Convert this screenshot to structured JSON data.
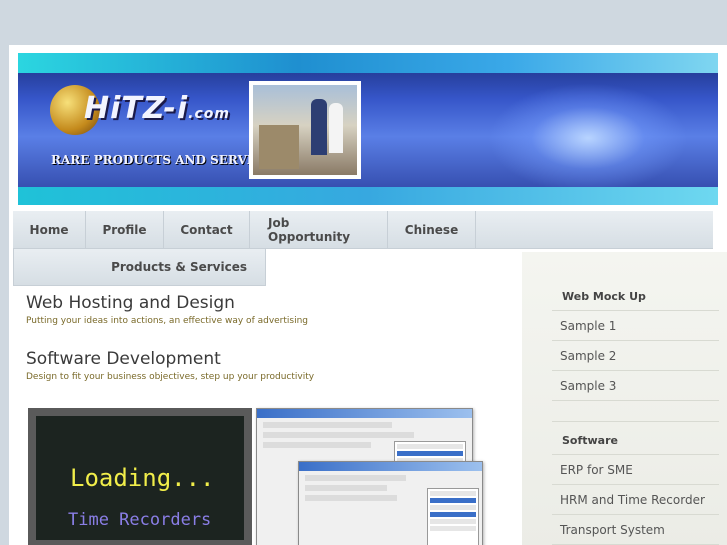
{
  "brand": {
    "logo_text": "HiTZ-i",
    "logo_domain": ".com",
    "logo_small_text": "Rare Products & Services Centre",
    "tagline": "RARE PRODUCTS AND SERVICES"
  },
  "nav": {
    "items": [
      "Home",
      "Profile",
      "Contact",
      "Job Opportunity",
      "Chinese"
    ],
    "second_row": [
      "Products & Services"
    ]
  },
  "main": {
    "sections": [
      {
        "title": "Web Hosting and Design",
        "subtitle": "Putting your ideas into actions, an effective way of advertising"
      },
      {
        "title": "Software Development",
        "subtitle": "Design to fit your business objectives, step up your productivity"
      }
    ],
    "screenshot": {
      "line1": "Loading...",
      "line2": "Time Recorders"
    }
  },
  "sidebar": {
    "groups": [
      {
        "heading": "Web Mock Up",
        "items": [
          "Sample 1",
          "Sample 2",
          "Sample 3"
        ]
      },
      {
        "heading": "Software",
        "items": [
          "ERP for SME",
          "HRM and Time Recorder",
          "Transport System"
        ]
      }
    ]
  },
  "colors": {
    "background": "#cfd8e0",
    "nav_bg": "#e2e8ed",
    "accent_yellow": "#f1ee4a",
    "accent_purple": "#8a7ee6",
    "banner_blue": "#3656c9"
  }
}
